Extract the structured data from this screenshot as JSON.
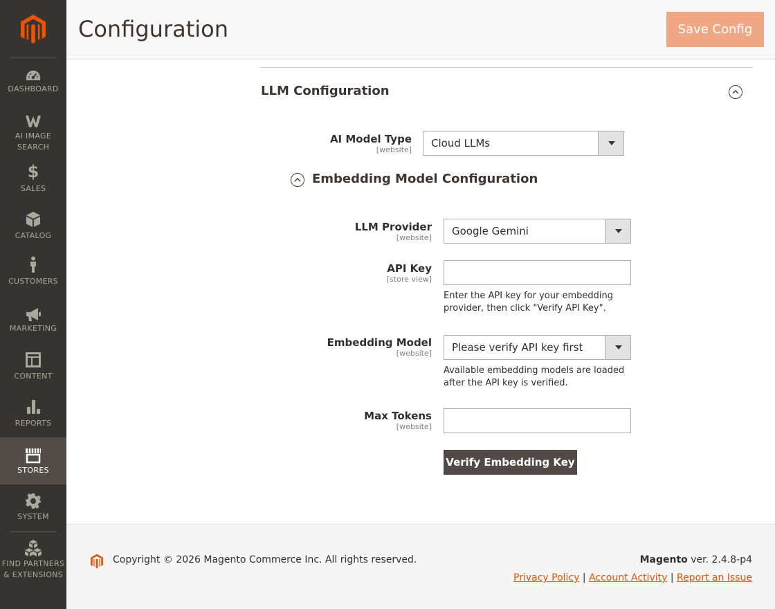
{
  "colors": {
    "brand": "#eb5202",
    "sidebar": "#373330",
    "sidebar_active": "#524d49",
    "save_button": "#f0a786",
    "dark_button": "#514943"
  },
  "sidebar": {
    "items": [
      {
        "label": "DASHBOARD",
        "icon": "dashboard-gauge-icon"
      },
      {
        "label": "AI IMAGE",
        "label2": "SEARCH",
        "icon": "ai-image-search-w-icon"
      },
      {
        "label": "SALES",
        "icon": "dollar-icon"
      },
      {
        "label": "CATALOG",
        "icon": "cube-icon"
      },
      {
        "label": "CUSTOMERS",
        "icon": "person-icon"
      },
      {
        "label": "MARKETING",
        "icon": "megaphone-icon"
      },
      {
        "label": "CONTENT",
        "icon": "layout-icon"
      },
      {
        "label": "REPORTS",
        "icon": "bar-chart-icon"
      },
      {
        "label": "STORES",
        "icon": "storefront-icon",
        "active": true
      },
      {
        "label": "SYSTEM",
        "icon": "gear-icon"
      },
      {
        "label": "FIND PARTNERS",
        "label2": "& EXTENSIONS",
        "icon": "boxes-icon"
      }
    ]
  },
  "header": {
    "title": "Configuration",
    "save_label": "Save Config"
  },
  "section": {
    "title": "LLM Configuration",
    "ai_model_type": {
      "label": "AI Model Type",
      "scope": "[website]",
      "value": "Cloud LLMs"
    },
    "embedding": {
      "title": "Embedding Model Configuration",
      "provider": {
        "label": "LLM Provider",
        "scope": "[website]",
        "value": "Google Gemini"
      },
      "api_key": {
        "label": "API Key",
        "scope": "[store view]",
        "value": "",
        "note_line1": "Enter the API key for your embedding",
        "note_line2": "provider, then click \"Verify API Key\"."
      },
      "model": {
        "label": "Embedding Model",
        "scope": "[website]",
        "value": "Please verify API key first",
        "note_line1": "Available embedding models are loaded",
        "note_line2": "after the API key is verified."
      },
      "max_tokens": {
        "label": "Max Tokens",
        "scope": "[website]",
        "value": ""
      },
      "verify_label": "Verify Embedding Key"
    }
  },
  "footer": {
    "copyright": "Copyright © 2026 Magento Commerce Inc. All rights reserved.",
    "brand": "Magento",
    "version": " ver. 2.4.8-p4",
    "links": {
      "privacy": "Privacy Policy",
      "activity": " Account Activity",
      "report": "Report an Issue"
    },
    "separator": "|"
  }
}
